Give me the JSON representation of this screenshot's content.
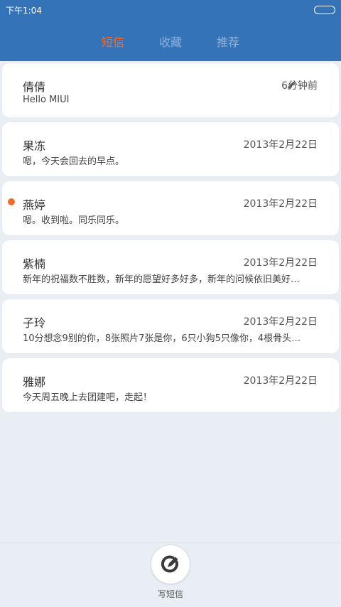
{
  "status_bar": {
    "time": "下午1:04"
  },
  "tabs": [
    {
      "label": "短信",
      "active": true
    },
    {
      "label": "收藏",
      "active": false
    },
    {
      "label": "推荐",
      "active": false
    }
  ],
  "conversations": [
    {
      "name": "倩倩",
      "time": "6分钟前",
      "message": "Hello MIUI",
      "draft": true,
      "unread": false
    },
    {
      "name": "果冻",
      "time": "2013年2月22日",
      "message": "嗯，今天会回去的早点。",
      "draft": false,
      "unread": false
    },
    {
      "name": "燕婷",
      "time": "2013年2月22日",
      "message": "嗯。收到啦。同乐同乐。",
      "draft": false,
      "unread": true
    },
    {
      "name": "紫楠",
      "time": "2013年2月22日",
      "message": "新年的祝福数不胜数，新年的愿望好多好多，新年的问候依旧美好…",
      "draft": false,
      "unread": false
    },
    {
      "name": "子玲",
      "time": "2013年2月22日",
      "message": "10分想念9别的你，8张照片7张是你，6只小狗5只像你，4根骨头…",
      "draft": false,
      "unread": false
    },
    {
      "name": "雅娜",
      "time": "2013年2月22日",
      "message": "今天周五晚上去团建吧，走起！",
      "draft": false,
      "unread": false
    }
  ],
  "compose": {
    "label": "写短信",
    "icon": "compose-icon"
  },
  "colors": {
    "header": "#3573b9",
    "accent": "#f06a2b",
    "background": "#e9eef5"
  }
}
